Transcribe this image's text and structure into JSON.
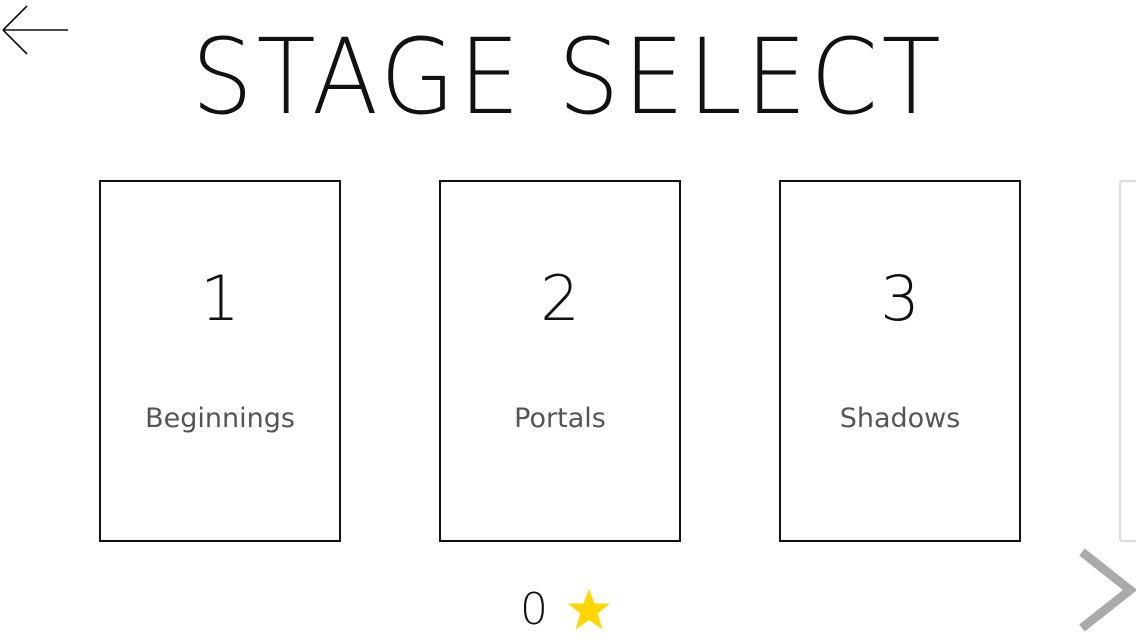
{
  "header": {
    "title": "STAGE SELECT",
    "back_icon": "arrow-left-icon"
  },
  "stages": [
    {
      "number": "1",
      "name": "Beginnings"
    },
    {
      "number": "2",
      "name": "Portals"
    },
    {
      "number": "3",
      "name": "Shadows"
    }
  ],
  "navigation": {
    "next_icon": "chevron-right-icon"
  },
  "stars": {
    "count": "0",
    "icon": "star-icon",
    "color": "#FFD700"
  },
  "colors": {
    "background": "#FFFFFF",
    "border": "#111111",
    "label_text": "#555555",
    "chevron": "#AAAAAA",
    "peek_border": "#DDDDDD"
  }
}
